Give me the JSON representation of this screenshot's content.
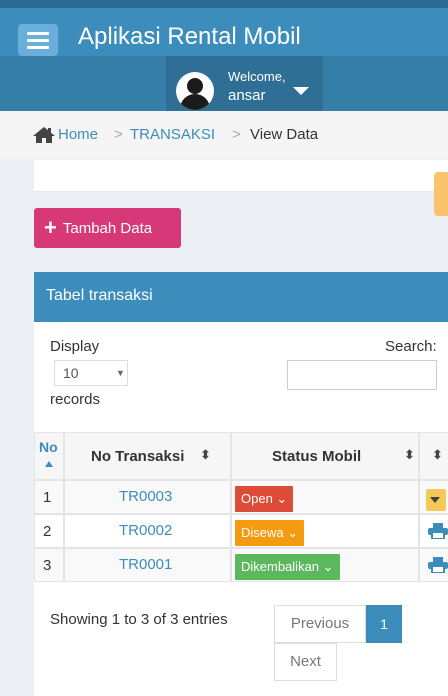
{
  "header": {
    "app_title": "Aplikasi Rental Mobil",
    "welcome": "Welcome,",
    "username": "ansar",
    "colors": {
      "primary": "#3c8dbc",
      "dark": "#367fa9"
    }
  },
  "breadcrumb": {
    "home": "Home",
    "separator": ">",
    "section": "TRANSAKSI",
    "current": "View Data"
  },
  "toolbar": {
    "add_label": "Tambah Data",
    "add_color": "#d73978"
  },
  "box": {
    "title": "Tabel transaksi"
  },
  "datatable": {
    "display_label": "Display",
    "length_value": "10",
    "records_label": "records",
    "search_label": "Search:",
    "search_value": "",
    "columns": [
      "No",
      "No Transaksi",
      "Status Mobil"
    ],
    "rows": [
      {
        "no": "1",
        "id": "TR0003",
        "status": "Open",
        "status_color": "#dd4b39",
        "action_icon": "dropdown-icon"
      },
      {
        "no": "2",
        "id": "TR0002",
        "status": "Disewa",
        "status_color": "#f39c12",
        "action_icon": "print-icon"
      },
      {
        "no": "3",
        "id": "TR0001",
        "status": "Dikembalikan",
        "status_color": "#5cb85c",
        "action_icon": "print-icon"
      }
    ],
    "info": "Showing 1 to 3 of 3 entries",
    "pagination": {
      "previous": "Previous",
      "current_page": "1",
      "next": "Next"
    }
  }
}
